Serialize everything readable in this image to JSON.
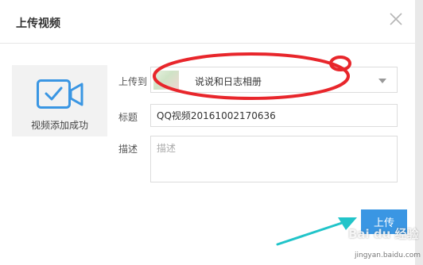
{
  "dialog": {
    "title": "上传视频",
    "close_icon": "close-icon"
  },
  "preview": {
    "icon": "video-camera-check-icon",
    "status": "视频添加成功"
  },
  "form": {
    "upload_to_label": "上传到",
    "album_value": "说说和日志相册",
    "title_label": "标题",
    "title_value": "QQ视频20161002170636",
    "desc_label": "描述",
    "desc_placeholder": "描述"
  },
  "actions": {
    "upload_label": "上传"
  },
  "watermark": {
    "brand": "Bai du 经验",
    "site": "jingyan.baidu.com"
  },
  "colors": {
    "accent": "#3a96e3",
    "annotation_red": "#e8262b",
    "annotation_arrow": "#21c4c9"
  }
}
